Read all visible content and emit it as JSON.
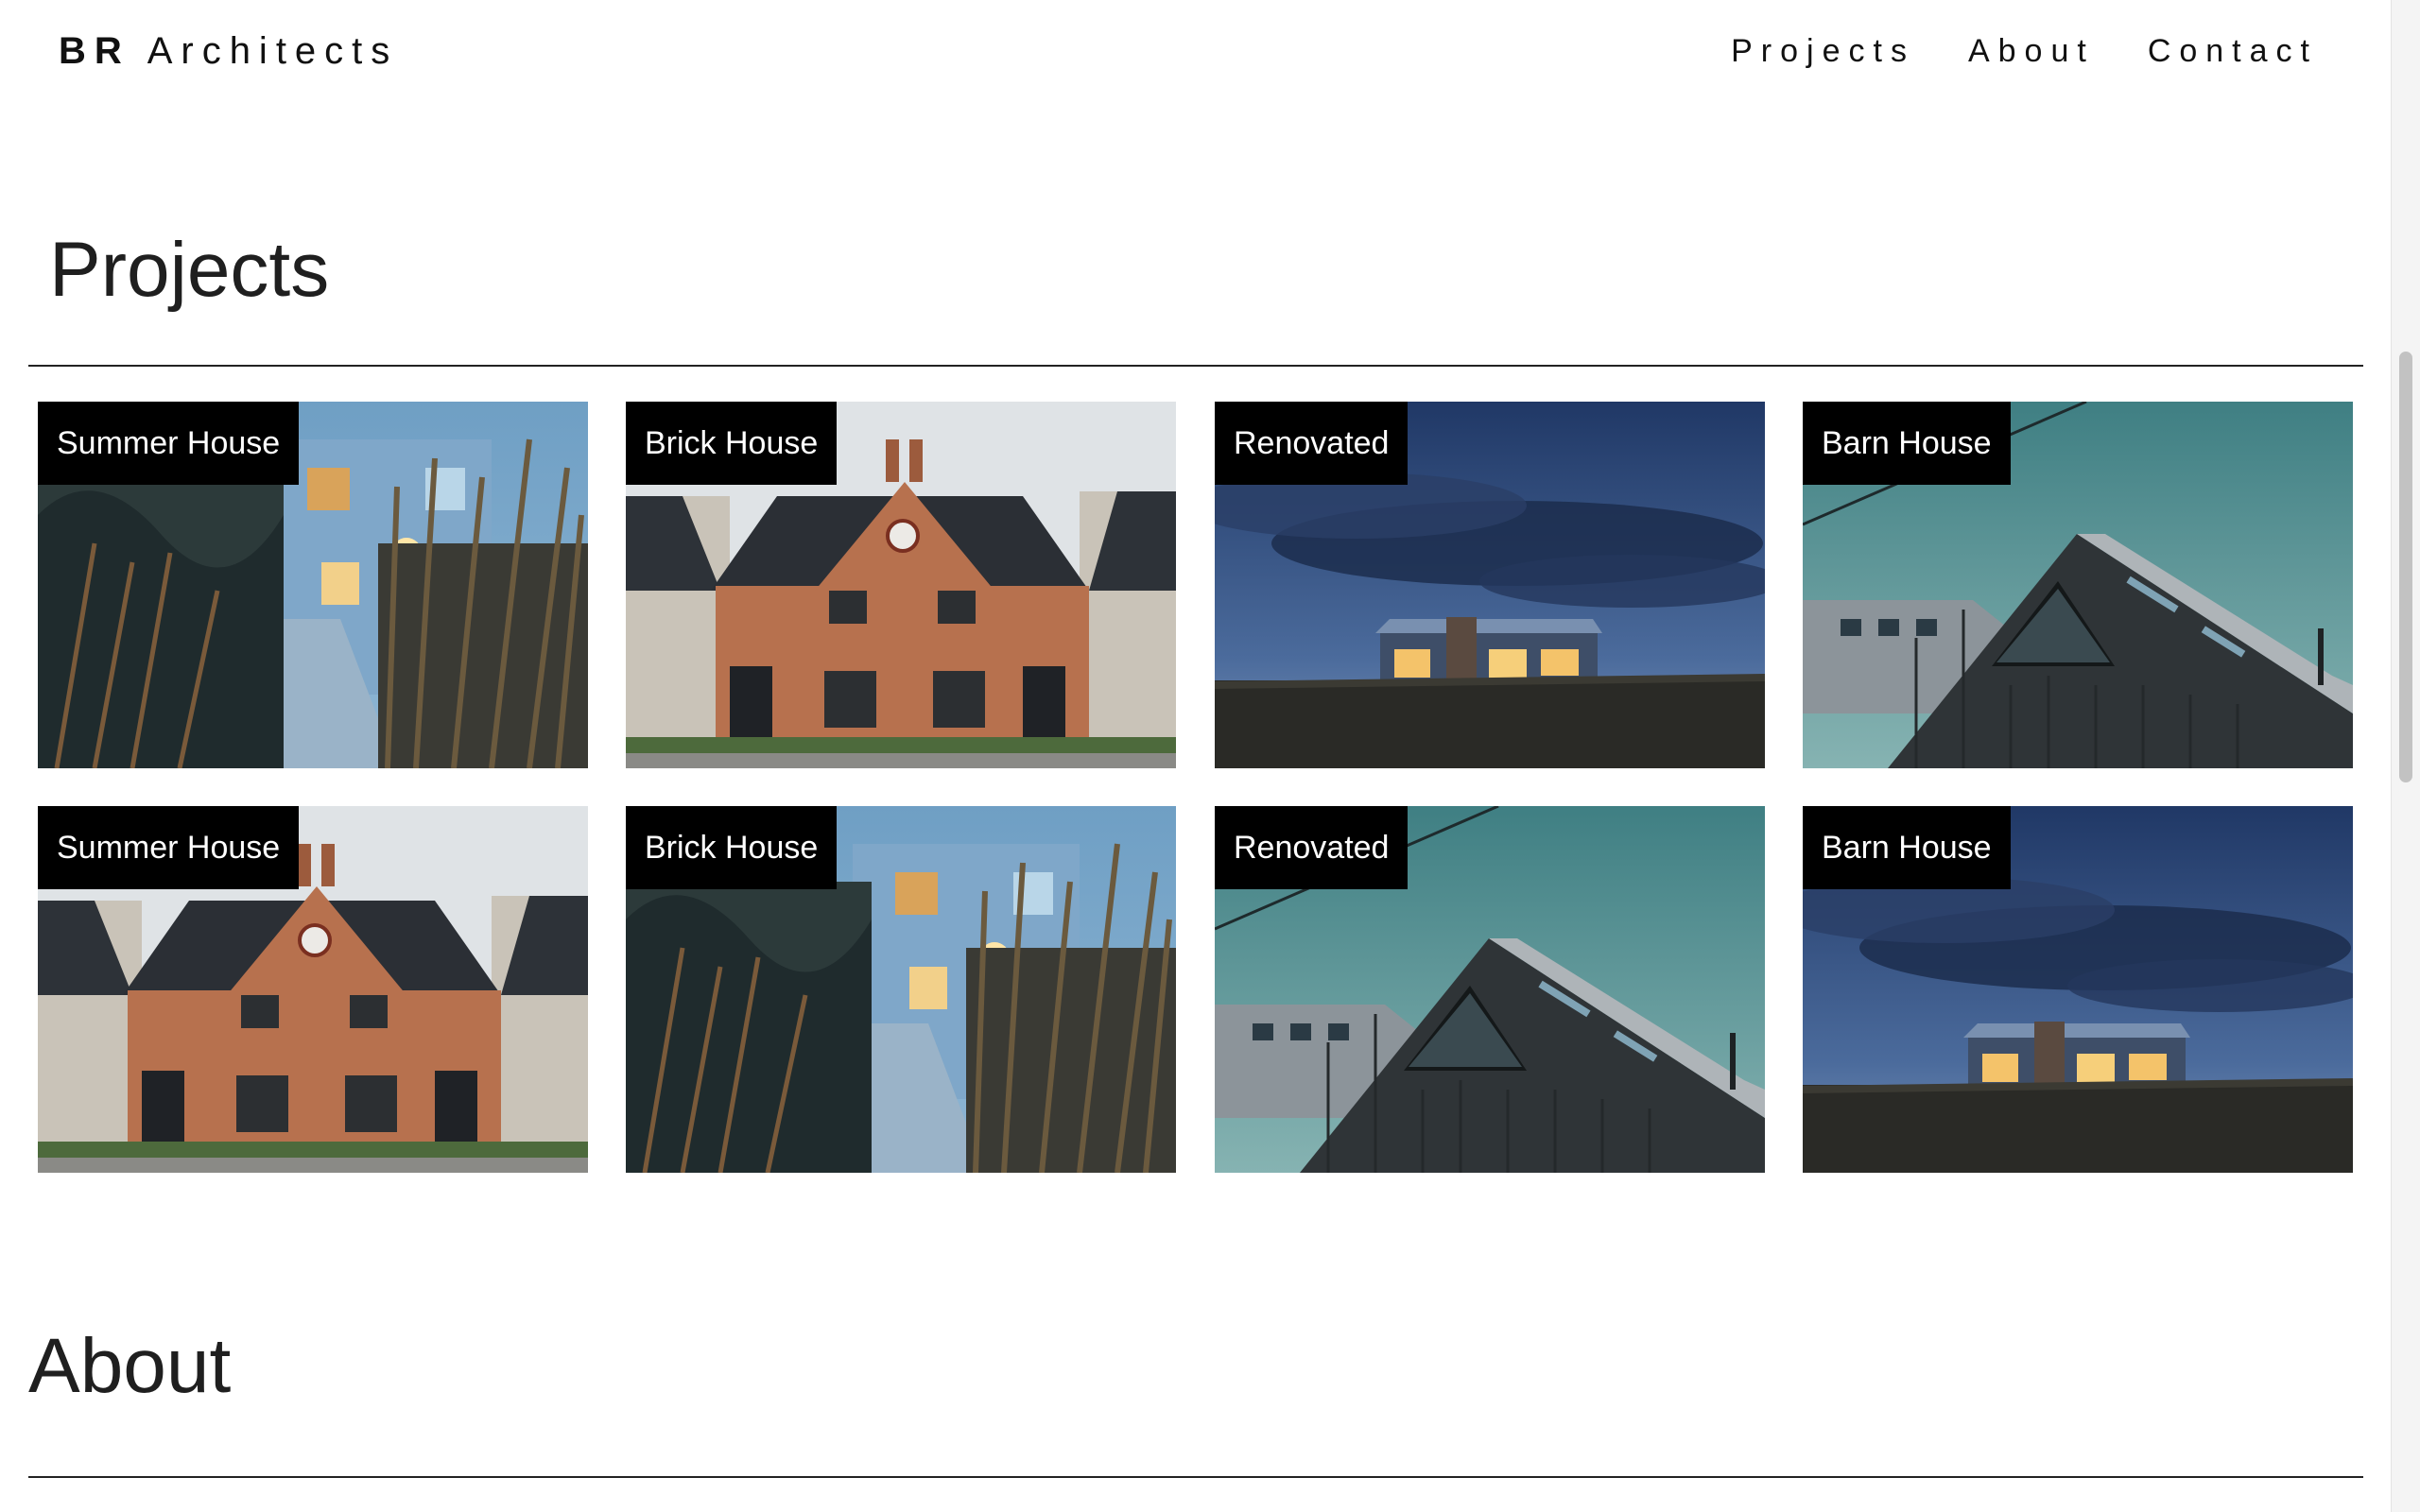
{
  "brand": {
    "bold": "BR",
    "rest": "Architects"
  },
  "nav": [
    {
      "label": "Projects"
    },
    {
      "label": "About"
    },
    {
      "label": "Contact"
    }
  ],
  "projects": {
    "title": "Projects",
    "cards": [
      {
        "label": "Summer House",
        "scene": "summer"
      },
      {
        "label": "Brick House",
        "scene": "brick"
      },
      {
        "label": "Renovated",
        "scene": "night"
      },
      {
        "label": "Barn House",
        "scene": "barn"
      },
      {
        "label": "Summer House",
        "scene": "brick"
      },
      {
        "label": "Brick House",
        "scene": "summer"
      },
      {
        "label": "Renovated",
        "scene": "barn"
      },
      {
        "label": "Barn House",
        "scene": "night"
      }
    ]
  },
  "about": {
    "title": "About"
  }
}
